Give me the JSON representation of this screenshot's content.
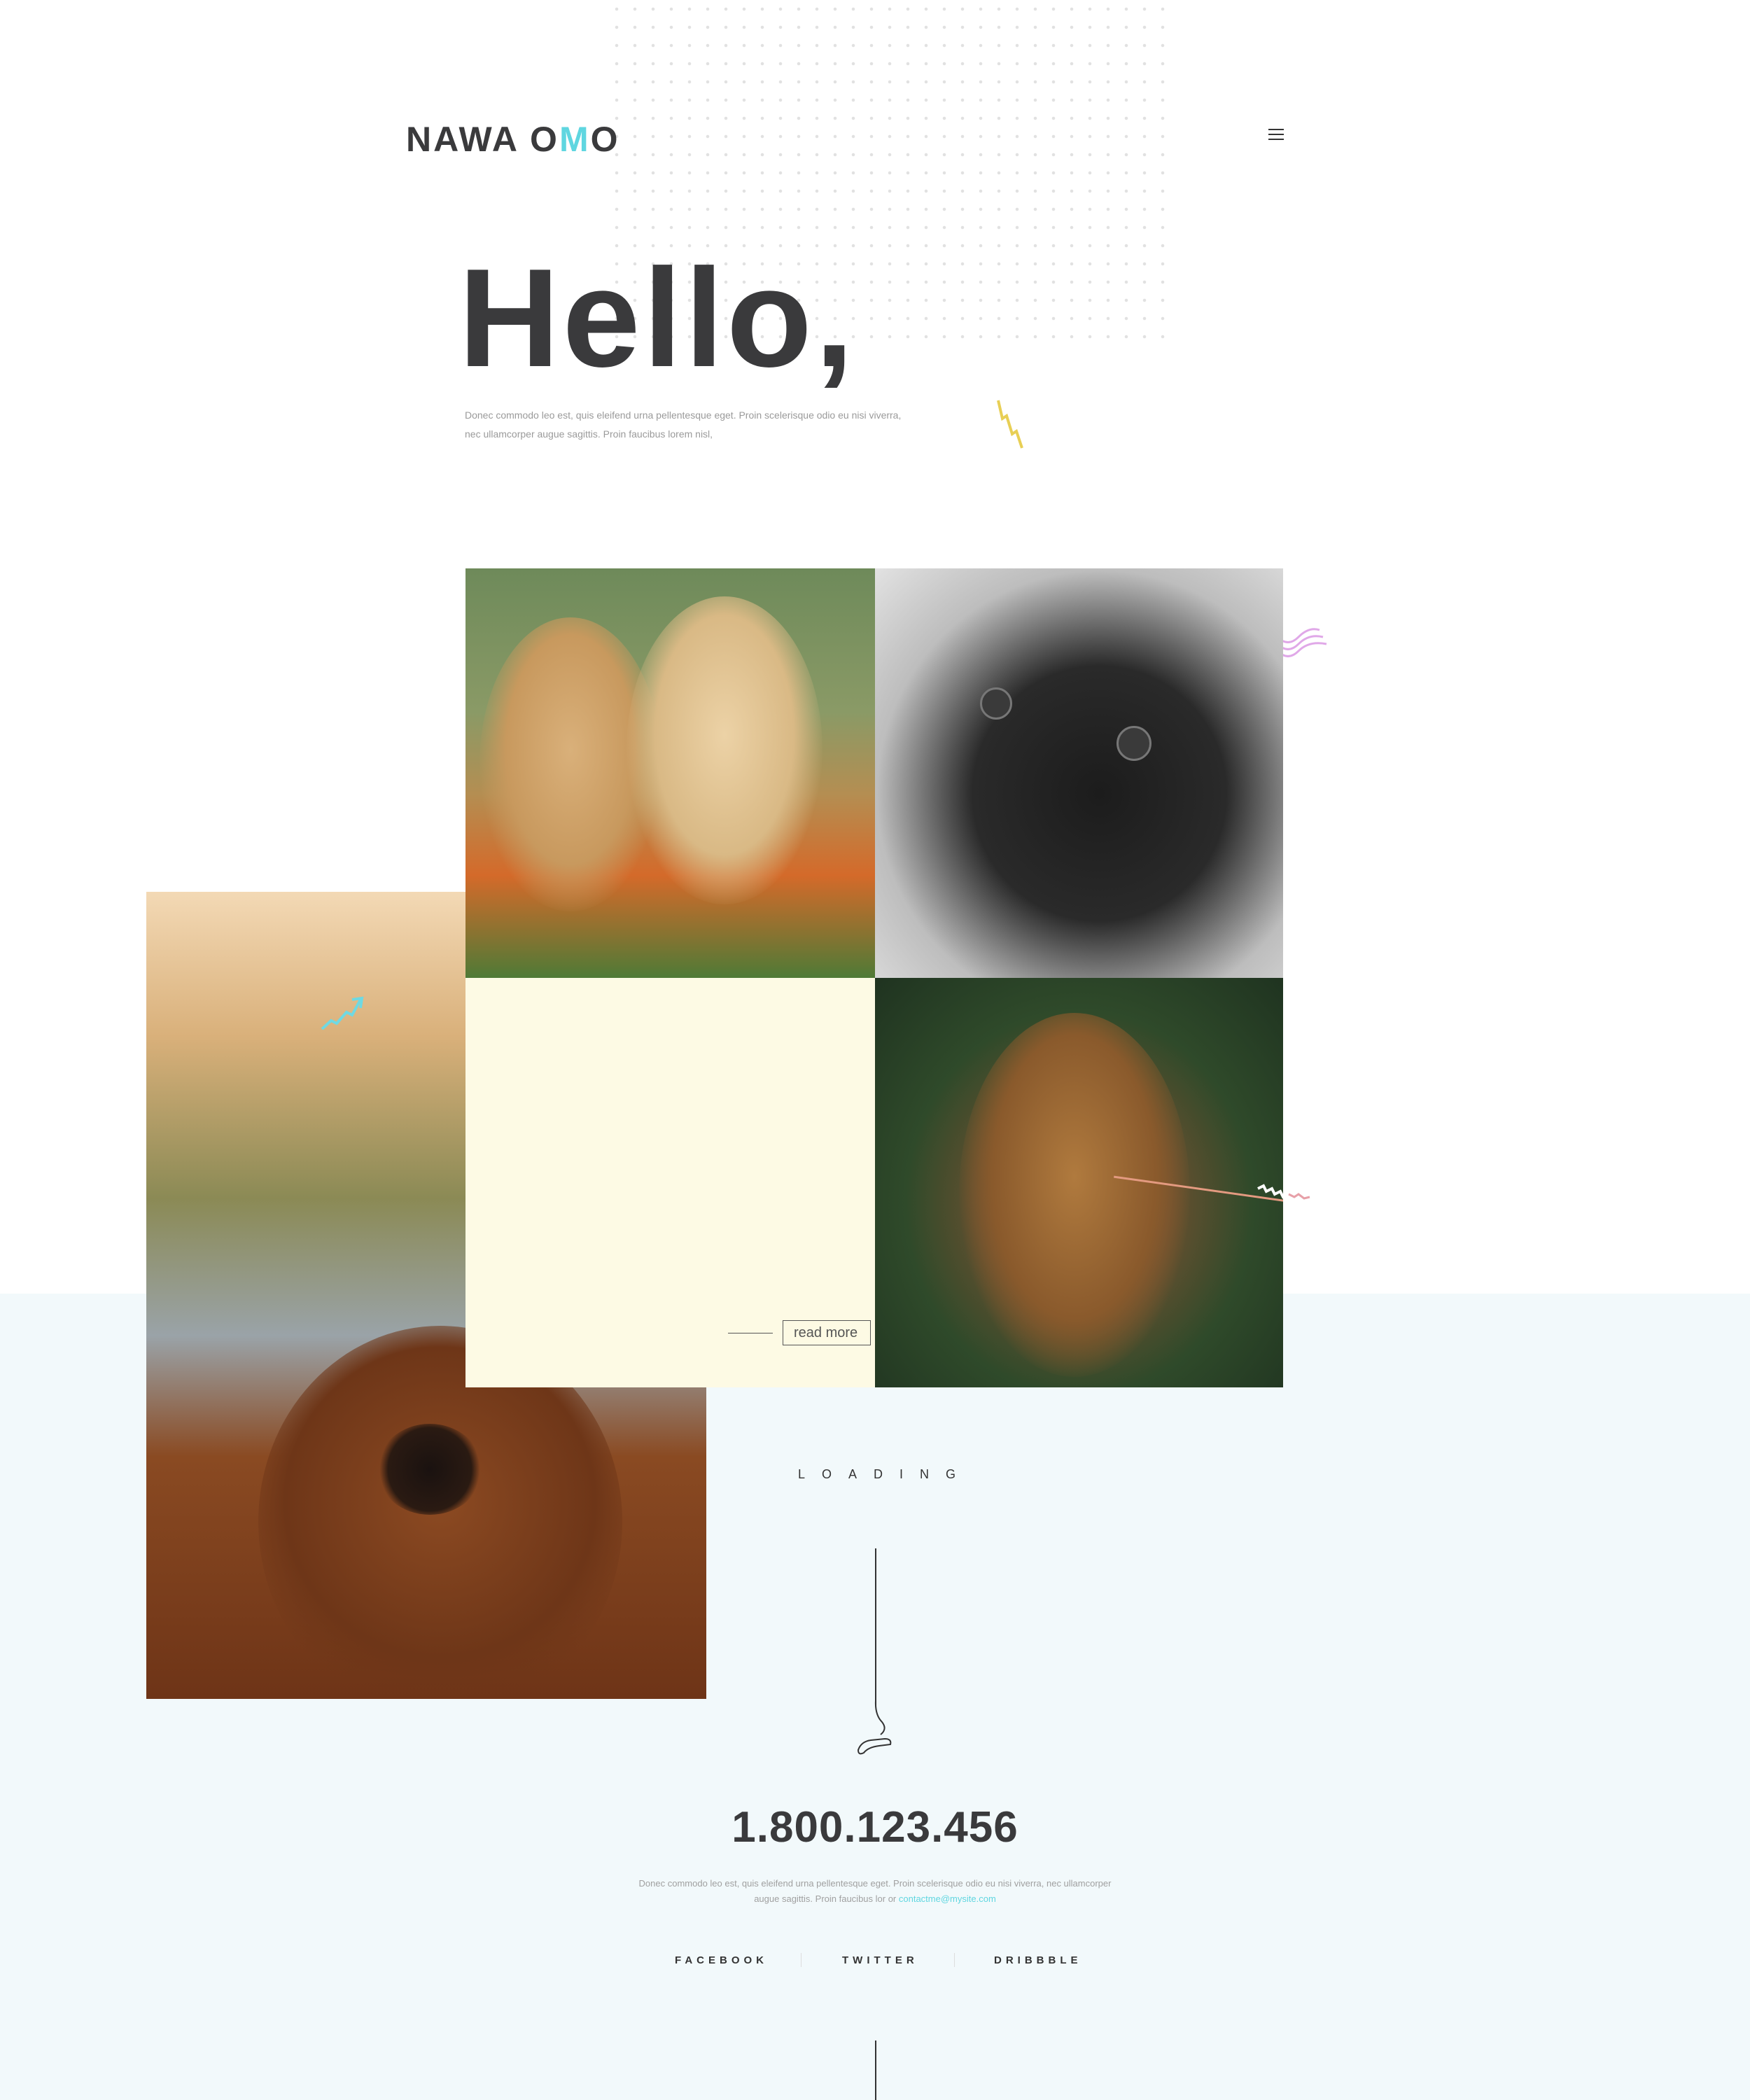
{
  "header": {
    "logo_main": "NAWA ",
    "logo_o": "O",
    "logo_accent": "M",
    "logo_end": "O",
    "menu_icon": "hamburger-icon"
  },
  "hero": {
    "title": "Hello,",
    "text": "Donec commodo leo est, quis eleifend urna pellentesque eget. Proin scelerisque odio eu nisi viverra, nec ullamcorper augue sagittis. Proin faucibus lorem nisl,"
  },
  "gallery": {
    "read_more_label": "read more"
  },
  "loading": {
    "label": "LOADING"
  },
  "contact": {
    "phone": "1.800.123.456",
    "text": "Donec commodo leo est, quis eleifend urna pellentesque eget. Proin scelerisque odio eu nisi viverra, nec ullamcorper augue sagittis. Proin faucibus lor or ",
    "email": "contactme@mysite.com"
  },
  "social": {
    "facebook": "FACEBOOK",
    "twitter": "TWITTER",
    "dribbble": "DRIBBBLE"
  },
  "colors": {
    "accent": "#5fd6e0",
    "dark": "#3a3a3c",
    "band": "#f2f9fb",
    "cream": "#fdfae4"
  }
}
